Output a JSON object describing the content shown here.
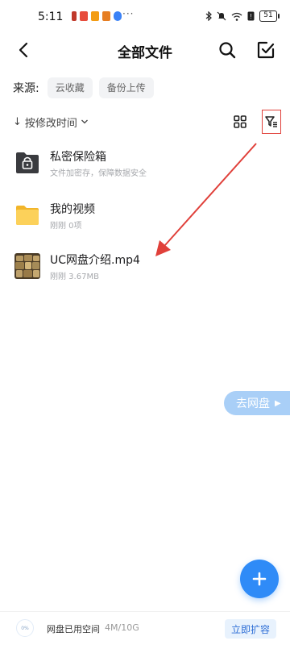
{
  "status_bar": {
    "time": "5:11",
    "dots": "···",
    "battery": "51"
  },
  "header": {
    "title": "全部文件"
  },
  "source": {
    "label": "来源:",
    "chips": [
      "云收藏",
      "备份上传"
    ]
  },
  "sort": {
    "label": "按修改时间"
  },
  "files": [
    {
      "name": "私密保险箱",
      "meta": "文件加密存，保障数据安全",
      "icon": "safe-folder-icon"
    },
    {
      "name": "我的视频",
      "meta": "刚刚  0项",
      "icon": "folder-icon"
    },
    {
      "name": "UC网盘介绍.mp4",
      "meta": "刚刚  3.67MB",
      "icon": "video-thumbnail"
    }
  ],
  "go_cloud": {
    "label": "去网盘"
  },
  "bottom": {
    "storage_percent": "0%",
    "storage_label": "网盘已用空间",
    "storage_value": "4M/10G",
    "expand_label": "立即扩容"
  },
  "colors": {
    "accent": "#2f8bf7",
    "annotation": "#e0403a",
    "folder": "#f9c23c"
  }
}
